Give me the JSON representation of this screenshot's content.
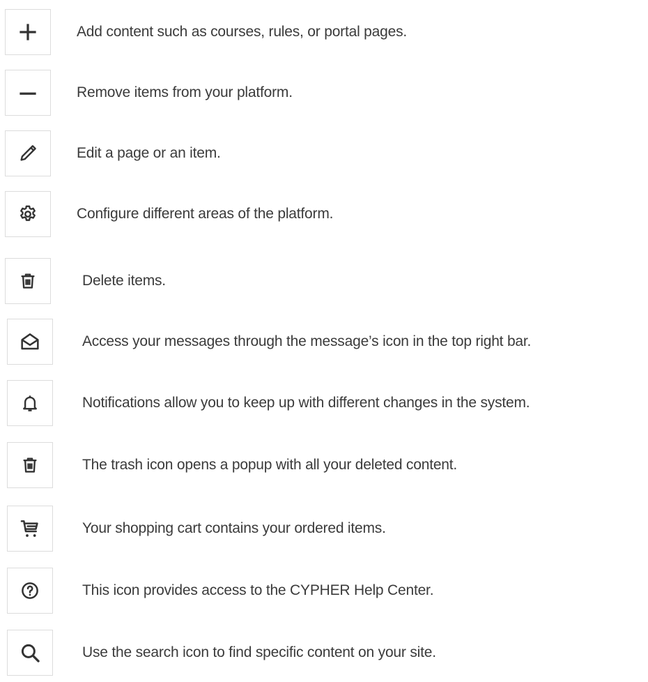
{
  "items": [
    {
      "icon": "plus-icon",
      "text": "Add content such as courses, rules, or portal pages."
    },
    {
      "icon": "minus-icon",
      "text": "Remove items from your platform."
    },
    {
      "icon": "pencil-icon",
      "text": "Edit a page or an item."
    },
    {
      "icon": "gear-icon",
      "text": "Configure different areas of the platform."
    },
    {
      "icon": "trash-icon",
      "text": "Delete items."
    },
    {
      "icon": "envelope-open-icon",
      "text": "Access your messages through the message’s icon in the top right bar."
    },
    {
      "icon": "bell-icon",
      "text": "Notifications allow you to keep up with different changes in the system."
    },
    {
      "icon": "trash-icon",
      "text": "The trash icon opens a popup with all your deleted content."
    },
    {
      "icon": "shopping-cart-icon",
      "text": "Your shopping cart contains your ordered items."
    },
    {
      "icon": "help-circle-icon",
      "text": "This icon provides access to the CYPHER Help Center."
    },
    {
      "icon": "search-icon",
      "text": "Use the search icon to find specific content on your site."
    }
  ],
  "colors": {
    "icon": "#333333",
    "text": "#3b3b3b",
    "border": "#dcdcdc"
  }
}
